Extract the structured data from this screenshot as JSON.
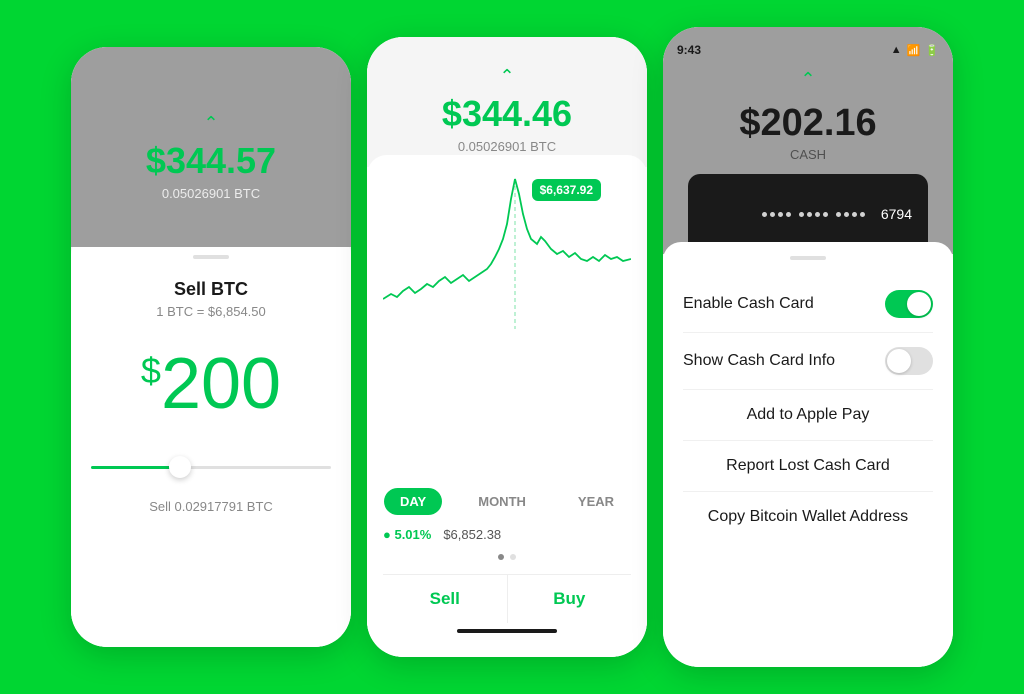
{
  "screen1": {
    "header_amount": "$344.57",
    "header_sub": "0.05026901 BTC",
    "sell_title": "Sell BTC",
    "sell_rate": "1 BTC = $6,854.50",
    "sell_amount_dollar": "$",
    "sell_amount_value": "200",
    "sell_btc_label": "Sell 0.02917791 BTC"
  },
  "screen2": {
    "header_amount": "$344.46",
    "header_sub": "0.05026901 BTC",
    "tooltip": "$6,637.92",
    "time_tabs": [
      "DAY",
      "MONTH",
      "YEAR"
    ],
    "active_tab": "DAY",
    "stat_percent": "● 5.01%",
    "stat_price": "$6,852.38",
    "sell_label": "Sell",
    "buy_label": "Buy"
  },
  "screen3": {
    "status_time": "9:43",
    "status_signal": "▲",
    "status_wifi": "WiFi",
    "status_battery": "Battery",
    "header_amount": "$202.16",
    "header_label": "CASH",
    "card_last4": "6794",
    "enable_card_label": "Enable Cash Card",
    "show_card_info_label": "Show Cash Card Info",
    "add_apple_pay_label": "Add to Apple Pay",
    "report_lost_label": "Report Lost Cash Card",
    "copy_btc_label": "Copy Bitcoin Wallet Address"
  },
  "colors": {
    "green": "#00c853",
    "bg_green": "#00d632"
  }
}
